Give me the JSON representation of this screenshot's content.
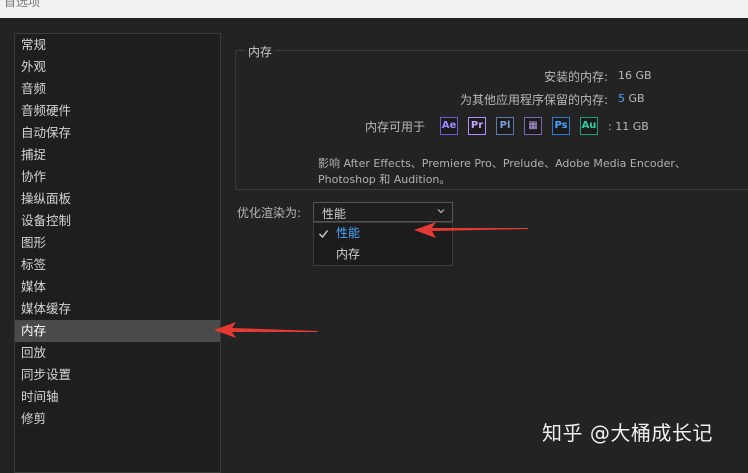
{
  "window": {
    "title": "首选项"
  },
  "sidebar": {
    "items": [
      {
        "label": "常规"
      },
      {
        "label": "外观"
      },
      {
        "label": "音频"
      },
      {
        "label": "音频硬件"
      },
      {
        "label": "自动保存"
      },
      {
        "label": "捕捉"
      },
      {
        "label": "协作"
      },
      {
        "label": "操纵面板"
      },
      {
        "label": "设备控制"
      },
      {
        "label": "图形"
      },
      {
        "label": "标签"
      },
      {
        "label": "媒体"
      },
      {
        "label": "媒体缓存"
      },
      {
        "label": "内存",
        "selected": true
      },
      {
        "label": "回放"
      },
      {
        "label": "同步设置"
      },
      {
        "label": "时间轴"
      },
      {
        "label": "修剪"
      }
    ]
  },
  "memory": {
    "group_title": "内存",
    "installed_label": "安装的内存:",
    "installed_value": "16 GB",
    "reserved_label": "为其他应用程序保留的内存:",
    "reserved_number": "5",
    "reserved_unit": "GB",
    "available_label": "内存可用于",
    "available_value": ": 11 GB",
    "apps": [
      {
        "abbr": "Ae",
        "name": "after-effects",
        "color": "#9a8cff"
      },
      {
        "abbr": "Pr",
        "name": "premiere-pro",
        "color": "#c4a6ff"
      },
      {
        "abbr": "Pl",
        "name": "prelude",
        "color": "#7aa0d8"
      },
      {
        "abbr": "▦",
        "name": "media-encoder",
        "color": "#b89ee8"
      },
      {
        "abbr": "Ps",
        "name": "photoshop",
        "color": "#4aa3ff"
      },
      {
        "abbr": "Au",
        "name": "audition",
        "color": "#2fd0a8"
      }
    ],
    "desc_line1": "影响 After Effects、Premiere Pro、Prelude、Adobe Media Encoder、",
    "desc_line2": "Photoshop 和 Audition。"
  },
  "optimize": {
    "label": "优化渲染为:",
    "selected": "性能",
    "options": [
      {
        "label": "性能",
        "checked": true
      },
      {
        "label": "内存",
        "checked": false
      }
    ]
  },
  "colors": {
    "accent": "#4aa3ff",
    "arrow": "#e53935"
  },
  "watermark": "知乎 @大桶成长记"
}
